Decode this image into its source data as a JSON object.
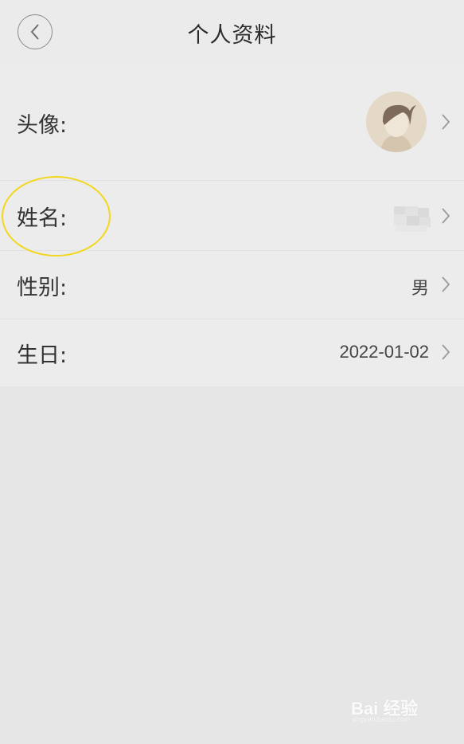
{
  "header": {
    "title": "个人资料",
    "back_icon": "chevron-left-icon"
  },
  "rows": [
    {
      "label": "头像:",
      "type": "avatar"
    },
    {
      "label": "姓名:",
      "type": "redacted"
    },
    {
      "label": "性别:",
      "value": "男"
    },
    {
      "label": "生日:",
      "value": "2022-01-02"
    }
  ],
  "colors": {
    "highlight": "#f2d71c",
    "background": "#e6e6e6",
    "card": "#ececec"
  },
  "watermark": {
    "text": "Bai 经验",
    "subtext": "jingyan.baidu.com"
  }
}
